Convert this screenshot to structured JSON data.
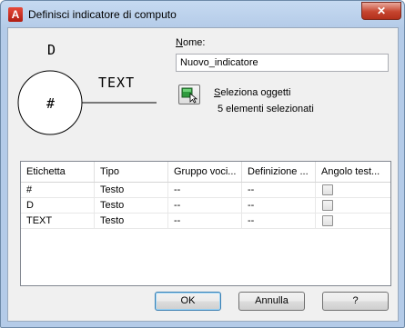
{
  "window": {
    "title": "Definisci indicatore di computo",
    "app_icon_glyph": "A",
    "close_glyph": "✕"
  },
  "preview": {
    "top_label": "D",
    "center_label": "#",
    "side_label": "TEXT"
  },
  "name": {
    "label_accel": "N",
    "label_rest": "ome:",
    "value": "Nuovo_indicatore"
  },
  "selection": {
    "label_accel": "S",
    "label_rest": "eleziona oggetti",
    "count_text": "5 elementi selezionati",
    "icon": "select-objects-icon"
  },
  "table": {
    "columns": [
      "Etichetta",
      "Tipo",
      "Gruppo voci...",
      "Definizione ...",
      "Angolo test..."
    ],
    "rows": [
      {
        "label": "#",
        "type": "Testo",
        "group": "--",
        "definition": "--",
        "angle_checked": false
      },
      {
        "label": "D",
        "type": "Testo",
        "group": "--",
        "definition": "--",
        "angle_checked": false
      },
      {
        "label": "TEXT",
        "type": "Testo",
        "group": "--",
        "definition": "--",
        "angle_checked": false
      }
    ]
  },
  "buttons": {
    "ok": "OK",
    "cancel": "Annulla",
    "help": "?"
  },
  "colors": {
    "title_gradient_top": "#c6daf1",
    "close_button": "#c6452f",
    "default_button_border": "#3c7fb1"
  }
}
